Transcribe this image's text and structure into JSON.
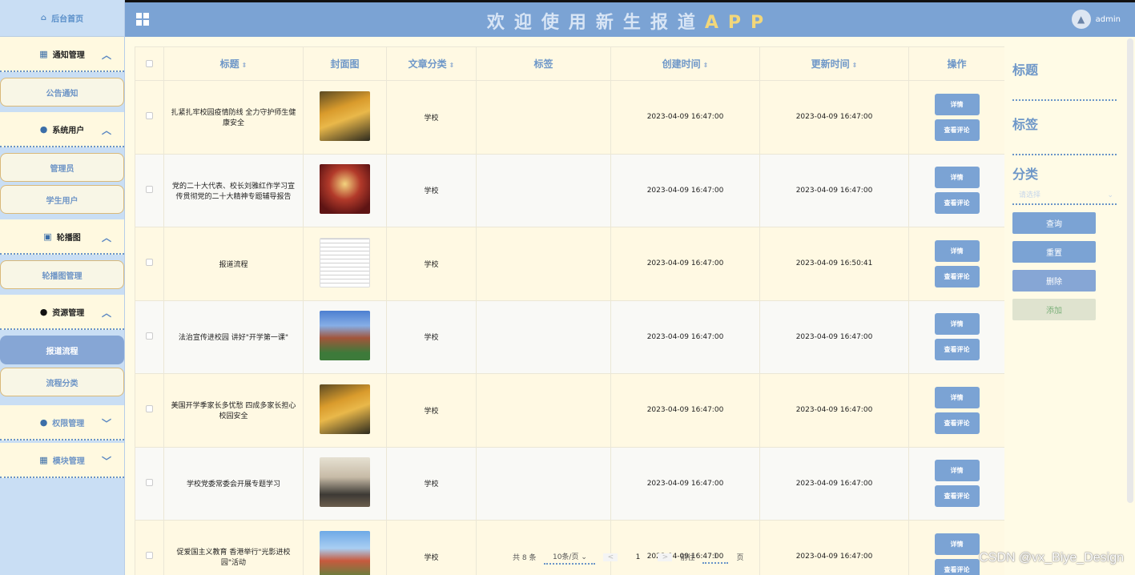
{
  "header": {
    "title_part1": "欢迎使用新生报道",
    "title_part2": "APP",
    "user": "admin"
  },
  "sidebar": {
    "home": "后台首页",
    "groups": [
      {
        "label": "通知管理",
        "icon": "bell-icon",
        "subs": [
          "公告通知"
        ]
      },
      {
        "label": "系统用户",
        "icon": "user-icon",
        "subs": [
          "管理员",
          "学生用户"
        ]
      },
      {
        "label": "轮播图",
        "icon": "image-icon",
        "subs": [
          "轮播图管理"
        ]
      },
      {
        "label": "资源管理",
        "icon": "drop-icon",
        "subs": [
          "报道流程",
          "流程分类"
        ]
      },
      {
        "label": "权限管理",
        "icon": "user-icon",
        "subs": []
      },
      {
        "label": "模块管理",
        "icon": "grid-icon",
        "subs": []
      }
    ]
  },
  "table": {
    "headers": [
      "标题",
      "封面图",
      "文章分类",
      "标签",
      "创建时间",
      "更新时间",
      "操作"
    ],
    "rows": [
      {
        "title": "扎紧扎牢校园疫情防线 全力守护师生健康安全",
        "cover": "autumn-campus",
        "category": "学校",
        "tag": "",
        "created": "2023-04-09 16:47:00",
        "updated": "2023-04-09 16:47:00"
      },
      {
        "title": "党的二十大代表、校长刘雅红作学习宣传贯彻党的二十大精神专题辅导报告",
        "cover": "lecture-hall",
        "category": "学校",
        "tag": "",
        "created": "2023-04-09 16:47:00",
        "updated": "2023-04-09 16:47:00"
      },
      {
        "title": "报道流程",
        "cover": "document",
        "category": "学校",
        "tag": "",
        "created": "2023-04-09 16:47:00",
        "updated": "2023-04-09 16:50:41"
      },
      {
        "title": "法治宣传进校园 讲好\"开学第一课\"",
        "cover": "building",
        "category": "学校",
        "tag": "",
        "created": "2023-04-09 16:47:00",
        "updated": "2023-04-09 16:47:00"
      },
      {
        "title": "美国开学季家长多忧愁 四成多家长担心校园安全",
        "cover": "autumn-campus",
        "category": "学校",
        "tag": "",
        "created": "2023-04-09 16:47:00",
        "updated": "2023-04-09 16:47:00"
      },
      {
        "title": "学校党委常委会开展专题学习",
        "cover": "meeting",
        "category": "学校",
        "tag": "",
        "created": "2023-04-09 16:47:00",
        "updated": "2023-04-09 16:47:00"
      },
      {
        "title": "促爱国主义教育 香港举行\"光影进校园\"活动",
        "cover": "tower",
        "category": "学校",
        "tag": "",
        "created": "2023-04-09 16:47:00",
        "updated": "2023-04-09 16:47:00"
      }
    ],
    "op_detail": "详情",
    "op_comments": "查看评论"
  },
  "pager": {
    "total": "共 8 条",
    "size": "10条/页",
    "prev": "<",
    "page": "1",
    "next": ">",
    "goto_label": "前往",
    "goto_value": "1",
    "page_unit": "页"
  },
  "panel": {
    "title_label": "标题",
    "tag_label": "标签",
    "category_label": "分类",
    "category_placeholder": "请选择",
    "query": "查询",
    "reset": "重置",
    "delete": "删除",
    "add": "添加"
  },
  "watermark": "CSDN @vx_Biye_Design"
}
